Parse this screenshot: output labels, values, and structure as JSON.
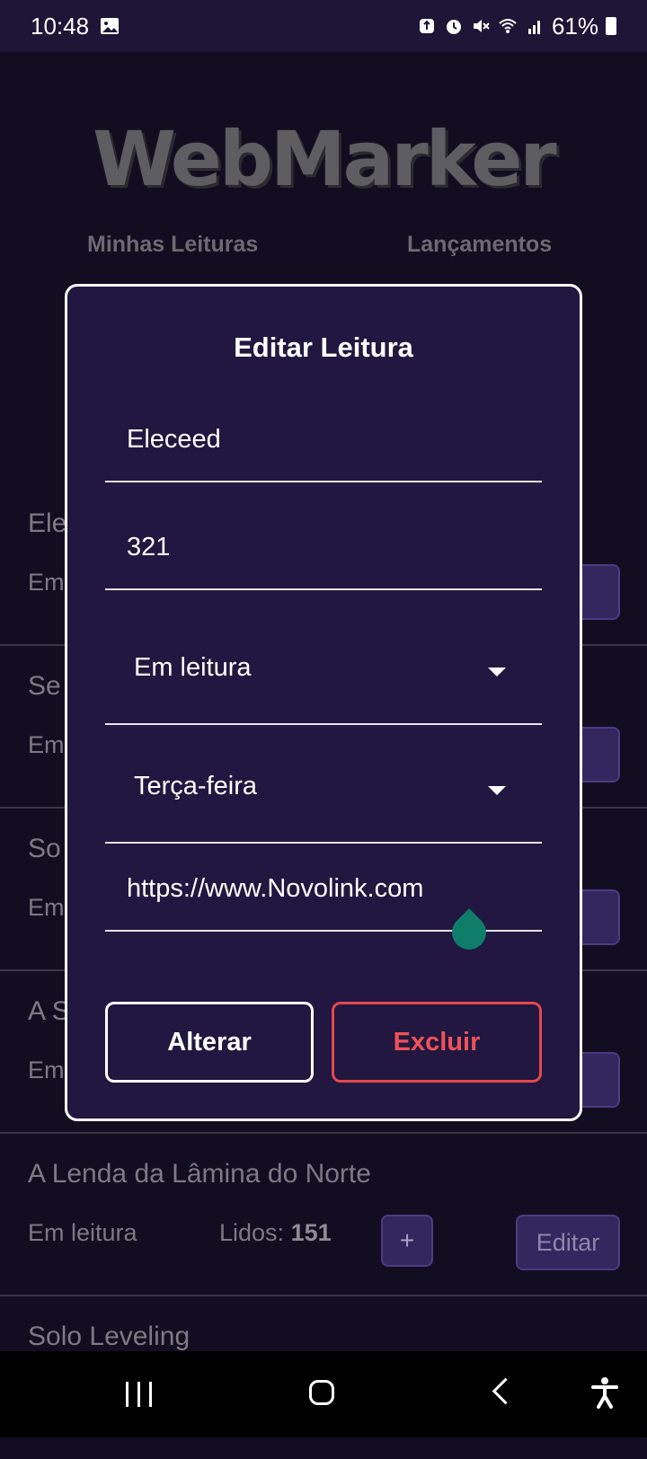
{
  "status_bar": {
    "time": "10:48",
    "battery": "61%",
    "icons": [
      "image-icon",
      "recycle-icon",
      "alarm-icon",
      "mute-icon",
      "wifi-icon",
      "signal-icon",
      "battery-icon"
    ]
  },
  "app": {
    "logo": "WebMarker",
    "nav": {
      "my_readings": "Minhas Leituras",
      "releases": "Lançamentos"
    },
    "readings": [
      {
        "title": "Ele",
        "status": "Em",
        "edit": "ar"
      },
      {
        "title": "Se",
        "status": "Em",
        "edit": "ar"
      },
      {
        "title": "So",
        "status": "Em",
        "edit": "ar"
      },
      {
        "title": "A S",
        "status": "Em",
        "edit": "ar"
      },
      {
        "title": "A Lenda da Lâmina do Norte",
        "status": "Em leitura",
        "read_label": "Lidos:",
        "read_count": "151",
        "plus": "+",
        "edit": "Editar"
      },
      {
        "title": "Solo Leveling"
      }
    ]
  },
  "modal": {
    "title": "Editar Leitura",
    "name_value": "Eleceed",
    "chapter_value": "321",
    "status_value": "Em leitura",
    "day_value": "Terça-feira",
    "link_value": "https://www.Novolink.com",
    "alter_label": "Alterar",
    "delete_label": "Excluir"
  },
  "colors": {
    "background": "#130d22",
    "modal_bg": "#211740",
    "accent_button": "#34265f",
    "delete": "#e5484d",
    "handle": "#0f7d6a"
  }
}
